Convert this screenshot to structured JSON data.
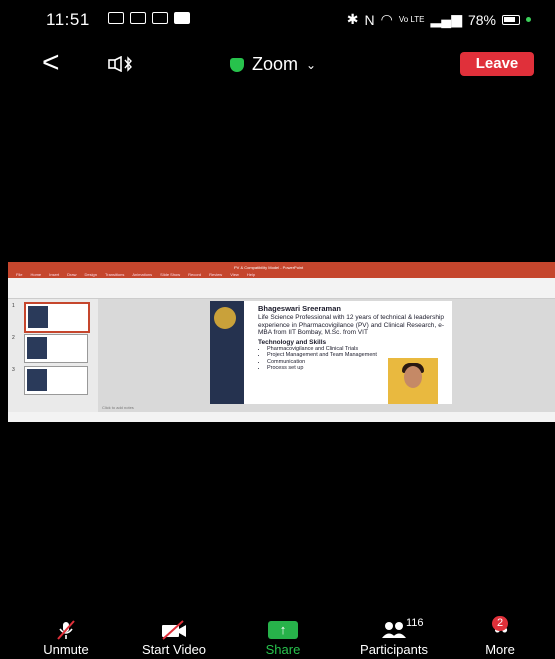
{
  "status_bar": {
    "time": "11:51",
    "battery": "78%",
    "network": "Vo LTE"
  },
  "header": {
    "meeting_title": "Zoom",
    "leave_label": "Leave"
  },
  "shared_screen": {
    "window_title": "PV & Compatibility Model - PowerPoint",
    "ribbon_tabs": [
      "File",
      "Home",
      "Insert",
      "Draw",
      "Design",
      "Transitions",
      "Animations",
      "Slide Show",
      "Record",
      "Review",
      "View",
      "Help"
    ],
    "notes_placeholder": "Click to add notes",
    "slide": {
      "name": "Bhageswari Sreeraman",
      "description": "Life Science Professional with 12 years of technical & leadership experience in Pharmacovigilance (PV) and Clinical Research, e-MBA from IIT Bombay, M.Sc. from VIT",
      "skills_heading": "Technology and Skills",
      "skills": [
        "Pharmacovigilance and Clinical Trials",
        "Project Management and Team Management",
        "Communication",
        "Process set up"
      ]
    },
    "thumbnails": [
      "1",
      "2",
      "3"
    ]
  },
  "toolbar": {
    "unmute_label": "Unmute",
    "start_video_label": "Start Video",
    "share_label": "Share",
    "participants_label": "Participants",
    "participants_count": "116",
    "more_label": "More",
    "more_badge": "2"
  },
  "colors": {
    "leave": "#e0303a",
    "share": "#27b24a",
    "shield": "#27c24c",
    "ppt_ribbon": "#c5462d"
  }
}
